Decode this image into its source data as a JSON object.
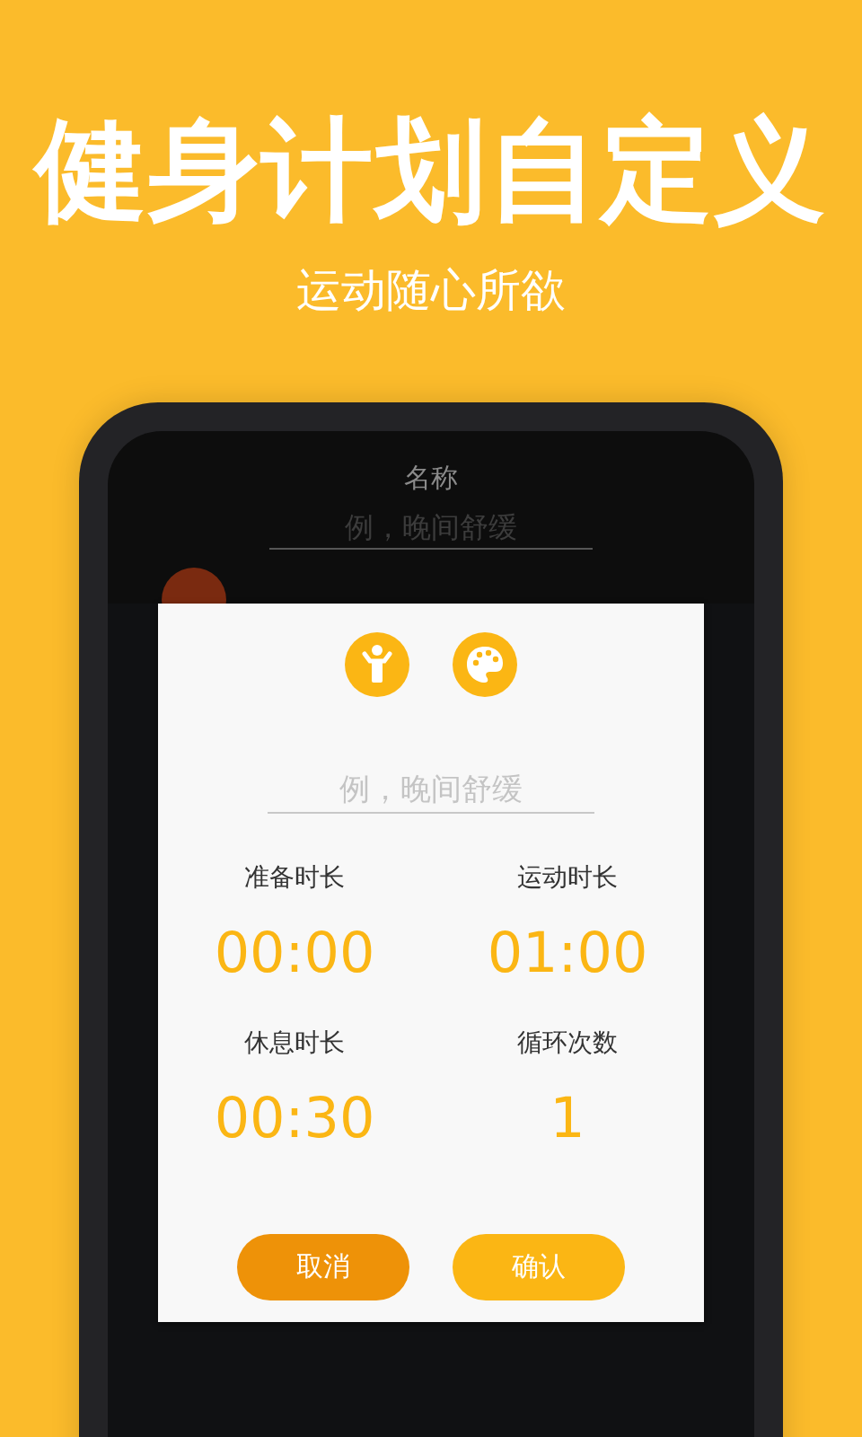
{
  "headline": "健身计划自定义",
  "subtitle": "运动随心所欲",
  "background_screen": {
    "label": "名称",
    "name_field": {
      "placeholder": "例，晚间舒缓"
    }
  },
  "dialog": {
    "name_field": {
      "placeholder": "例，晚间舒缓"
    },
    "settings": [
      {
        "label": "准备时长",
        "value": "00:00"
      },
      {
        "label": "运动时长",
        "value": "01:00"
      },
      {
        "label": "休息时长",
        "value": "00:30"
      },
      {
        "label": "循环次数",
        "value": "1"
      }
    ],
    "buttons": [
      {
        "label": "取消",
        "kind": "cancel"
      },
      {
        "label": "确认",
        "kind": "confirm"
      }
    ]
  }
}
